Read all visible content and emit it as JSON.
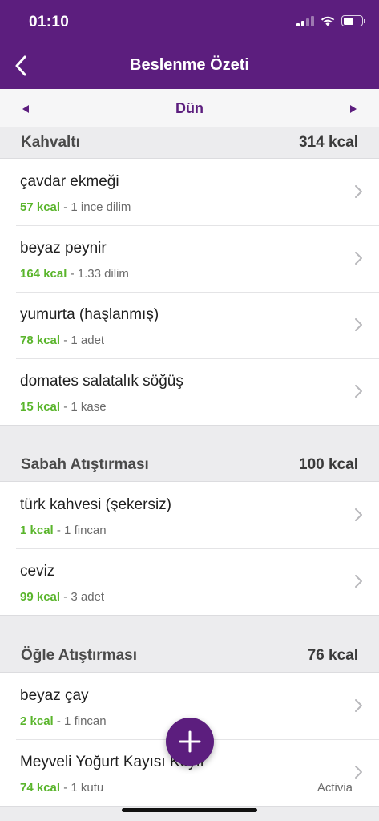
{
  "status": {
    "time": "01:10"
  },
  "header": {
    "title": "Beslenme Özeti"
  },
  "date_bar": {
    "label": "Dün"
  },
  "sections": [
    {
      "title": "Kahvaltı",
      "kcal": "314 kcal",
      "items": [
        {
          "name": "çavdar ekmeği",
          "kcal": "57 kcal",
          "portion": "- 1 ince dilim"
        },
        {
          "name": "beyaz peynir",
          "kcal": "164 kcal",
          "portion": "- 1.33 dilim"
        },
        {
          "name": "yumurta (haşlanmış)",
          "kcal": "78 kcal",
          "portion": "- 1 adet"
        },
        {
          "name": "domates salatalık söğüş",
          "kcal": "15 kcal",
          "portion": "- 1 kase"
        }
      ]
    },
    {
      "title": "Sabah Atıştırması",
      "kcal": "100 kcal",
      "items": [
        {
          "name": "türk kahvesi (şekersiz)",
          "kcal": "1 kcal",
          "portion": "- 1 fincan"
        },
        {
          "name": "ceviz",
          "kcal": "99 kcal",
          "portion": "- 3 adet"
        }
      ]
    },
    {
      "title": "Öğle Atıştırması",
      "kcal": "76 kcal",
      "items": [
        {
          "name": "beyaz çay",
          "kcal": "2 kcal",
          "portion": "- 1 fincan"
        },
        {
          "name": "Meyveli Yoğurt Kayısı Keyfi",
          "kcal": "74 kcal",
          "portion": "- 1 kutu",
          "brand": "Activia"
        }
      ]
    }
  ],
  "icons": {
    "back": "chevron-left-icon",
    "prev": "triangle-left-icon",
    "next": "triangle-right-icon",
    "row": "chevron-right-icon",
    "add": "plus-icon"
  },
  "colors": {
    "brand": "#5c1e7e",
    "calories": "#5ab52c"
  }
}
